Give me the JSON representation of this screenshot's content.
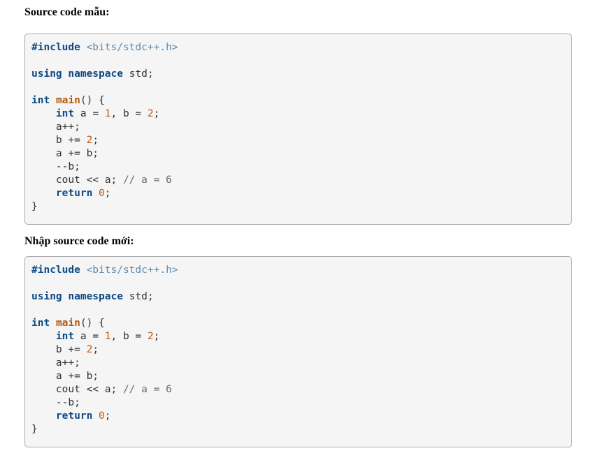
{
  "headings": {
    "sample": "Source code mẫu:",
    "input": "Nhập source code mới:"
  },
  "sample_code": {
    "include_directive": "#include",
    "include_header": "<bits/stdc++.h>",
    "using": "using",
    "namespace": "namespace",
    "std": " std;",
    "int": "int",
    "main": "main",
    "main_rest": "() {",
    "decl_int": "int",
    "decl_a": " a = ",
    "decl_1": "1",
    "decl_b": ", b = ",
    "decl_2": "2",
    "decl_end": ";",
    "line_inc_a": "a++;",
    "line_b_plus": "b += ",
    "line_b_val": "2",
    "line_b_end": ";",
    "line_a_plus_b": "a += b;",
    "line_dec_b": "--b;",
    "line_cout": "cout << a; ",
    "line_comment": "// a = 6",
    "return_kw": "return",
    "return_space": " ",
    "return_val": "0",
    "return_end": ";",
    "close": "}"
  },
  "input_code": {
    "include_directive": "#include",
    "include_header": "<bits/stdc++.h>",
    "using": "using",
    "namespace": "namespace",
    "std": " std;",
    "int": "int",
    "main": "main",
    "main_rest": "() {",
    "decl_int": "int",
    "decl_a": " a = ",
    "decl_1": "1",
    "decl_b": ", b = ",
    "decl_2": "2",
    "decl_end": ";",
    "line_b_plus": "b += ",
    "line_b_val": "2",
    "line_b_end": ";",
    "line_inc_a": "a++;",
    "line_a_plus_b": "a += b;",
    "line_cout": "cout << a; ",
    "line_comment": "// a = 6",
    "line_dec_b": "--b;",
    "return_kw": "return",
    "return_space": " ",
    "return_val": "0",
    "return_end": ";",
    "close": "}"
  }
}
